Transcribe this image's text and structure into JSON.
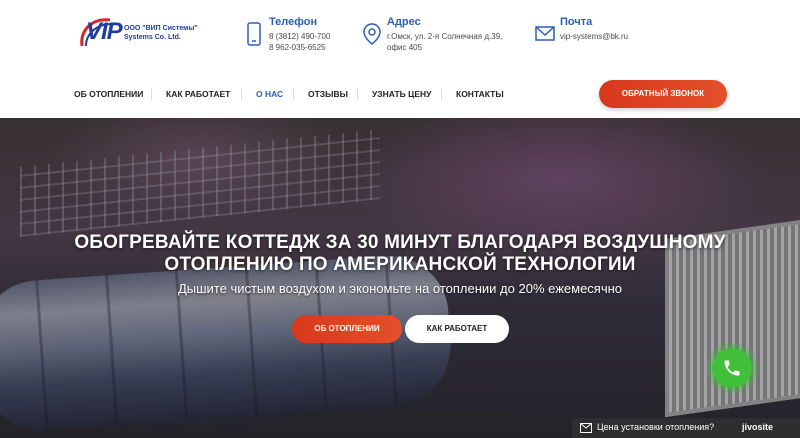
{
  "logo": {
    "brand": "VIP",
    "line1": "ООО \"ВИП Системы\"",
    "line2": "Systems Co. Ltd."
  },
  "contacts": {
    "phone": {
      "title": "Телефон",
      "lines": [
        "8 (3812) 490-700",
        "8 962-035-6525"
      ],
      "icon": "smartphone-icon"
    },
    "address": {
      "title": "Адрес",
      "lines": [
        "г.Омск, ул. 2-я Солнечная д.39,",
        "офис 405"
      ],
      "icon": "map-pin-icon"
    },
    "email": {
      "title": "Почта",
      "lines": [
        "vip-systems@bk.ru"
      ],
      "icon": "envelope-icon"
    }
  },
  "nav": {
    "items": [
      {
        "label": "ОБ ОТОПЛЕНИИ"
      },
      {
        "label": "КАК РАБОТАЕТ"
      },
      {
        "label": "О НАС"
      },
      {
        "label": "ОТЗЫВЫ"
      },
      {
        "label": "УЗНАТЬ ЦЕНУ"
      },
      {
        "label": "КОНТАКТЫ"
      }
    ],
    "active_index": 2,
    "callback_label": "ОБРАТНЫЙ ЗВОНОК"
  },
  "hero": {
    "title_line1": "ОБОГРЕВАЙТЕ КОТТЕДЖ ЗА 30 МИНУТ БЛАГОДАРЯ ВОЗДУШНОМУ",
    "title_line2": "ОТОПЛЕНИЮ ПО АМЕРИКАНСКОЙ ТЕХНОЛОГИИ",
    "subtitle": "Дышите чистым воздухом и экономьте на отоплении до 20% ежемесячно",
    "primary_button": "ОБ ОТОПЛЕНИИ",
    "secondary_button": "КАК РАБОТАЕТ"
  },
  "chat": {
    "text": "Цена установки отопления?",
    "brand": "jivosite"
  },
  "colors": {
    "accent": "#e2502a",
    "brand_blue": "#2b5fb5",
    "call_green": "#3fbf3a"
  }
}
